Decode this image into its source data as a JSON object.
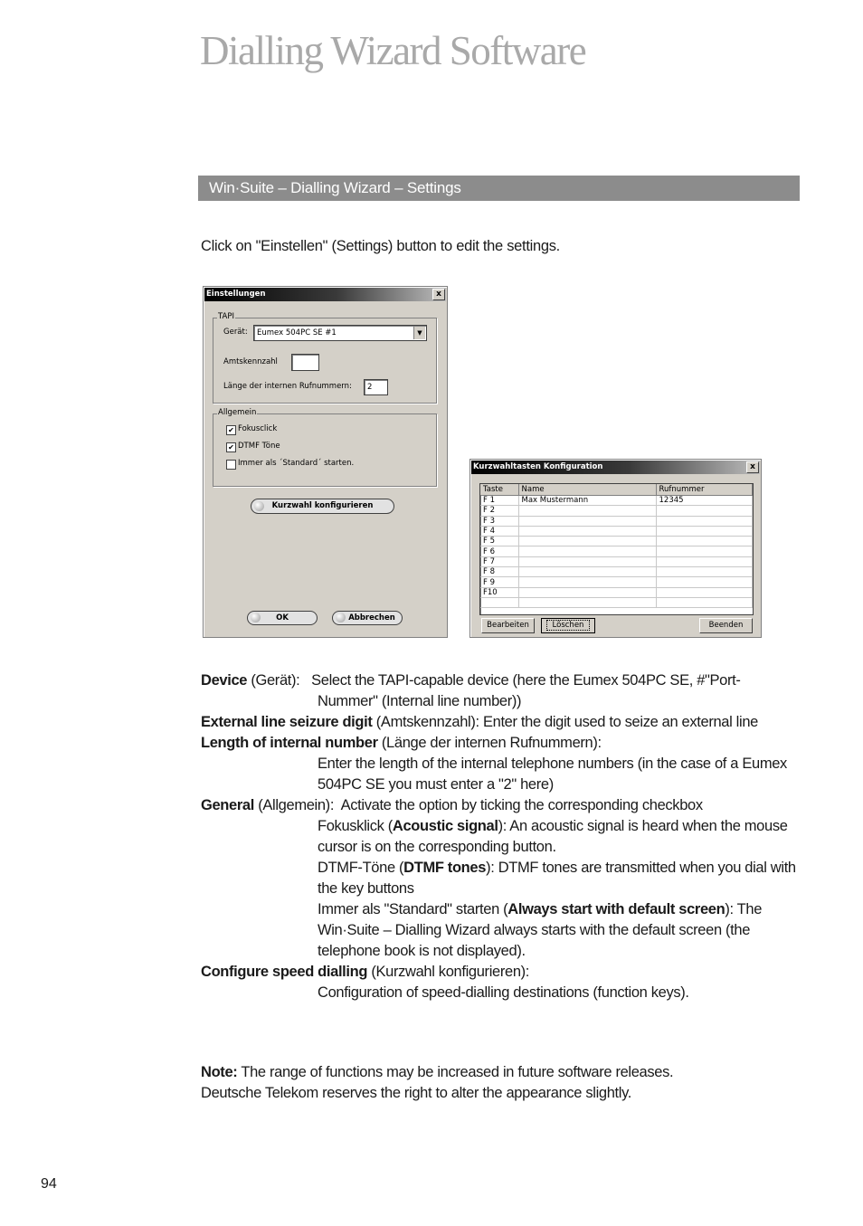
{
  "page": {
    "title": "Dialling Wizard Software",
    "section_title": "Win·Suite – Dialling Wizard – Settings",
    "intro": "Click on \"Einstellen\" (Settings) button to edit the settings.",
    "page_number": "94"
  },
  "settings_dialog": {
    "title": "Einstellungen",
    "close": "x",
    "tapi_group": "TAPI",
    "device_label": "Gerät:",
    "device_value": "Eumex 504PC SE #1",
    "external_label": "Amtskennzahl",
    "external_value": "",
    "length_label": "Länge der internen Rufnummern:",
    "length_value": "2",
    "general_group": "Allgemein",
    "checkboxes": [
      {
        "label": "Fokusclick",
        "checked": true
      },
      {
        "label": "DTMF Töne",
        "checked": true
      },
      {
        "label": "Immer als ´Standard´ starten.",
        "checked": false
      }
    ],
    "speed_button": "Kurzwahl konfigurieren",
    "ok_button": "OK",
    "cancel_button": "Abbrechen"
  },
  "speed_dialog": {
    "title": "Kurzwahltasten Konfiguration",
    "close": "x",
    "columns": [
      "Taste",
      "Name",
      "Rufnummer"
    ],
    "rows": [
      [
        "F 1",
        "Max Mustermann",
        "12345"
      ],
      [
        "F 2",
        "",
        ""
      ],
      [
        "F 3",
        "",
        ""
      ],
      [
        "F 4",
        "",
        ""
      ],
      [
        "F 5",
        "",
        ""
      ],
      [
        "F 6",
        "",
        ""
      ],
      [
        "F 7",
        "",
        ""
      ],
      [
        "F 8",
        "",
        ""
      ],
      [
        "F 9",
        "",
        ""
      ],
      [
        "F10",
        "",
        ""
      ],
      [
        "",
        "",
        ""
      ]
    ],
    "edit_button": "Bearbeiten",
    "delete_button": "Löschen",
    "exit_button": "Beenden"
  },
  "definitions": {
    "device_term": "Device",
    "device_rest": " (Gerät):   ",
    "device_text": "Select the TAPI-capable device (here the Eumex 504PC SE, #\"Port-Nummer\" (Internal line number))",
    "external_term": "External line seizure digit",
    "external_text": " (Amtskennzahl): Enter the digit used to seize an external line",
    "length_term": "Length of internal number",
    "length_rest": " (Länge der internen Rufnummern):",
    "length_text": "Enter the length of the internal telephone numbers (in the case of a Eumex 504PC SE you must enter a \"2\" here)",
    "general_term": "General",
    "general_text": " (Allgemein):  Activate the option by ticking the corresponding checkbox",
    "focus_a": "Fokusklick (",
    "focus_b": "Acoustic signal",
    "focus_c": "): An acoustic signal is heard when the mouse cursor is on the corresponding button.",
    "dtmf_a": "DTMF-Töne (",
    "dtmf_b": "DTMF tones",
    "dtmf_c": "): DTMF tones are transmitted when you dial with the key buttons",
    "std_a": "Immer als \"Standard\" starten (",
    "std_b": "Always start with default screen",
    "std_c": "): The Win·Suite – Dialling Wizard always starts with the default screen (the telephone book is not displayed).",
    "speed_term": "Configure speed dialling",
    "speed_rest": " (Kurzwahl konfigurieren):",
    "speed_text": "Configuration of speed-dialling destinations (function keys)."
  },
  "note": {
    "label": "Note:",
    "line1": " The range of functions may be increased in future software releases.",
    "line2": "Deutsche Telekom reserves the right to alter the appearance slightly."
  }
}
